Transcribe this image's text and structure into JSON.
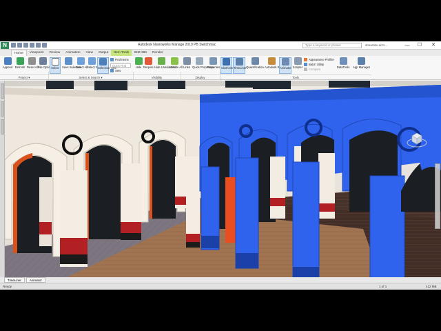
{
  "titlebar": {
    "title": "Autodesk Navisworks Manage 2019   PB Switchmac",
    "search_placeholder": "Type a keyword or phrase",
    "signin": "sbnambu.ai21...",
    "minimize": "—",
    "maximize": "☐",
    "close": "✕",
    "logo": "N"
  },
  "tabs": [
    {
      "label": "Home",
      "active": true
    },
    {
      "label": "Viewpoint"
    },
    {
      "label": "Review"
    },
    {
      "label": "Animation"
    },
    {
      "label": "View"
    },
    {
      "label": "Output"
    },
    {
      "label": "Item Tools",
      "context": true
    },
    {
      "label": "BIM 360"
    },
    {
      "label": "Render"
    }
  ],
  "ribbon": {
    "append": "Append",
    "refresh": "Refresh",
    "reset_all": "Reset All...",
    "file_options": "File Options",
    "select": "Select",
    "save_selection": "Save Selection",
    "select_all": "Select All",
    "select_same": "Select Same",
    "selection_tree": "Selection Tree",
    "find_items": "Find Items",
    "quick_find_placeholder": "Quick Find",
    "sets": "Sets",
    "hide": "Hide",
    "require": "Require",
    "hide_unselected": "Hide Unselected",
    "unhide_all": "Unhide All",
    "links": "Links",
    "quick_properties": "Quick Properties",
    "properties": "Properties",
    "clash_detective": "Clash Detective",
    "timeliner": "TimeLiner",
    "quantification": "Quantification",
    "autodesk_rendering": "Autodesk Rendering",
    "animator": "Animator",
    "scripter": "Scripter",
    "appearance_profiler": "Appearance Profiler",
    "batch_utility": "Batch Utility",
    "compare": "Compare",
    "datatools": "DataTools",
    "app_manager": "App Manager",
    "panel_project": "Project ▾",
    "panel_select_search": "Select & Search ▾",
    "panel_visibility": "Visibility",
    "panel_display": "Display",
    "panel_tools": "Tools"
  },
  "viewtabs": [
    "TimeLiner",
    "Animator"
  ],
  "status": {
    "left": "Ready",
    "pages": "1 of 1",
    "memory": "412 MB"
  },
  "colors": {
    "selection_blue": "#2f63ee",
    "wall_cream": "#efe8de",
    "floor_wood": "#9b7252",
    "base_red": "#b22024"
  }
}
